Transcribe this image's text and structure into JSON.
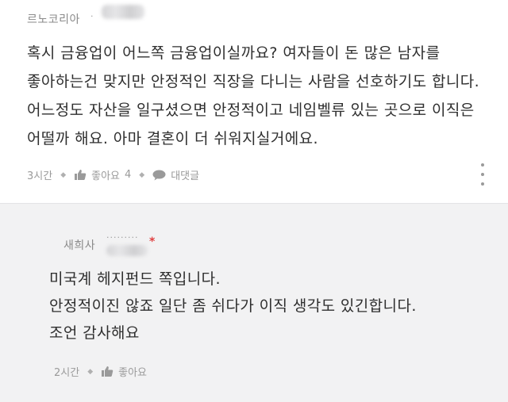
{
  "comment": {
    "author": "르노코리아",
    "author_masked_suffix": "·",
    "lines": [
      "혹시 금융업이 어느쪽 금융업이실까요? 여자들이 돈 많은 남자를",
      "좋아하는건 맞지만 안정적인 직장을 다니는 사람을 선호하기도 합니다.",
      "어느정도 자산을 일구셨으면 안정적이고 네임벨류 있는 곳으로 이직은",
      "어떨까 해요. 아마 결혼이 더 쉬워지실거에요."
    ],
    "time": "3시간",
    "like_label": "좋아요",
    "like_count": "4",
    "reply_label": "대댓글"
  },
  "reply": {
    "author": "새희사",
    "author_mask": "·········",
    "author_mark": "*",
    "lines": [
      "미국계 헤지펀드 쪽입니다.",
      "안정적이진 않죠 일단 좀 쉬다가 이직 생각도 있긴합니다.",
      "조언 감사해요"
    ],
    "time": "2시간",
    "like_label": "좋아요"
  },
  "colors": {
    "reply_background": "#f2f2f3",
    "meta_gray": "#9a9a9a",
    "author_mark": "#e04040"
  }
}
